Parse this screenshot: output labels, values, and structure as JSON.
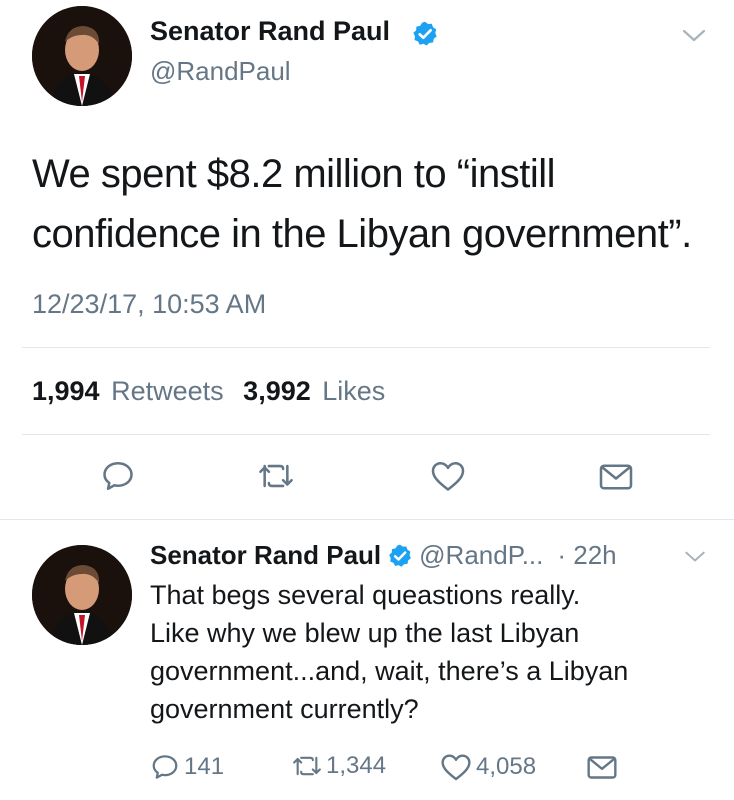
{
  "main_tweet": {
    "display_name": "Senator Rand Paul",
    "handle": "@RandPaul",
    "text_line1": "We spent $8.2 million to “instill",
    "text_line2": "confidence in the Libyan government”.",
    "timestamp": "12/23/17, 10:53 AM",
    "retweets_count": "1,994",
    "retweets_label": "Retweets",
    "likes_count": "3,992",
    "likes_label": "Likes"
  },
  "reply_tweet": {
    "display_name": "Senator Rand Paul",
    "handle": "@RandP...",
    "time": "· 22h",
    "text_line1": "That begs several queastions really.",
    "text_line2": "Like why we blew up the last Libyan",
    "text_line3": "government...and, wait, there’s a Libyan",
    "text_line4": "government currently?",
    "reply_count": "141",
    "retweet_count": "1,344",
    "like_count": "4,058"
  },
  "colors": {
    "verified_blue": "#1da1f2",
    "text_primary": "#14171a",
    "text_muted": "#657786",
    "divider": "#e1e8ed",
    "icon_gray": "#657786"
  },
  "icons": [
    "verified-icon",
    "chevron-down-icon",
    "reply-icon",
    "retweet-icon",
    "like-icon",
    "share-icon"
  ]
}
